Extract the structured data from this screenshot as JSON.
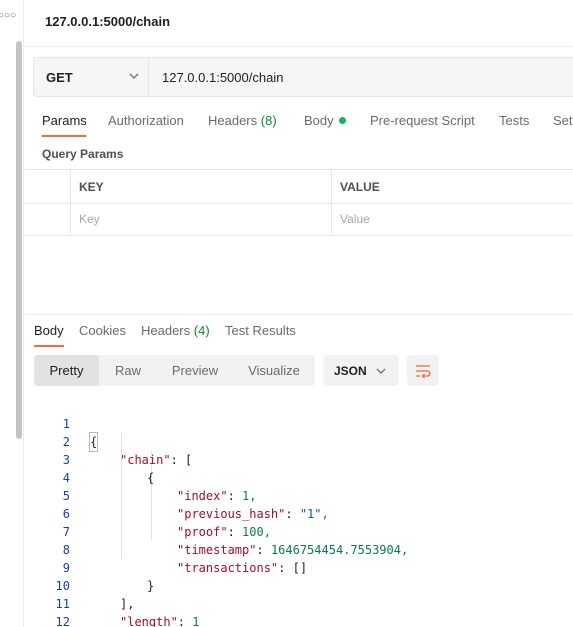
{
  "window": {
    "title": "127.0.0.1:5000/chain",
    "sidebar_icon": "more-dots-icon"
  },
  "request": {
    "method": "GET",
    "url": "127.0.0.1:5000/chain"
  },
  "request_tabs": [
    {
      "label": "Params",
      "active": true
    },
    {
      "label": "Authorization"
    },
    {
      "label": "Headers",
      "count": "(8)"
    },
    {
      "label": "Body",
      "indicator": "green-dot"
    },
    {
      "label": "Pre-request Script"
    },
    {
      "label": "Tests"
    },
    {
      "label": "Set"
    }
  ],
  "query_params": {
    "section_label": "Query Params",
    "columns": [
      "KEY",
      "VALUE"
    ],
    "placeholder_key": "Key",
    "placeholder_value": "Value"
  },
  "response_tabs": [
    {
      "label": "Body",
      "active": true
    },
    {
      "label": "Cookies"
    },
    {
      "label": "Headers",
      "count": "(4)"
    },
    {
      "label": "Test Results"
    }
  ],
  "view_modes": [
    "Pretty",
    "Raw",
    "Preview",
    "Visualize"
  ],
  "active_view": "Pretty",
  "format": "JSON",
  "code_lines": [
    {
      "n": "1",
      "text": "{"
    },
    {
      "n": "2",
      "text": "\"chain\": ["
    },
    {
      "n": "3",
      "text": "{"
    },
    {
      "n": "4",
      "key": "\"index\"",
      "value": "1,"
    },
    {
      "n": "5",
      "key": "\"previous_hash\"",
      "value": "\"1\","
    },
    {
      "n": "6",
      "key": "\"proof\"",
      "value": "100,"
    },
    {
      "n": "7",
      "key": "\"timestamp\"",
      "value": "1646754454.7553904,"
    },
    {
      "n": "8",
      "key": "\"transactions\"",
      "value": "[]"
    },
    {
      "n": "9",
      "text": "}"
    },
    {
      "n": "10",
      "text": "],"
    },
    {
      "n": "11",
      "key": "\"length\"",
      "value": "1"
    },
    {
      "n": "12",
      "text": "}"
    }
  ],
  "colors": {
    "accent": "#f26b3a",
    "count_green": "#0b8a2f",
    "dot_green": "#0cbb52",
    "json_key": "#a0102a",
    "json_number": "#0b7a55",
    "json_string": "#0d5a8c",
    "line_number": "#1a3ea6"
  }
}
